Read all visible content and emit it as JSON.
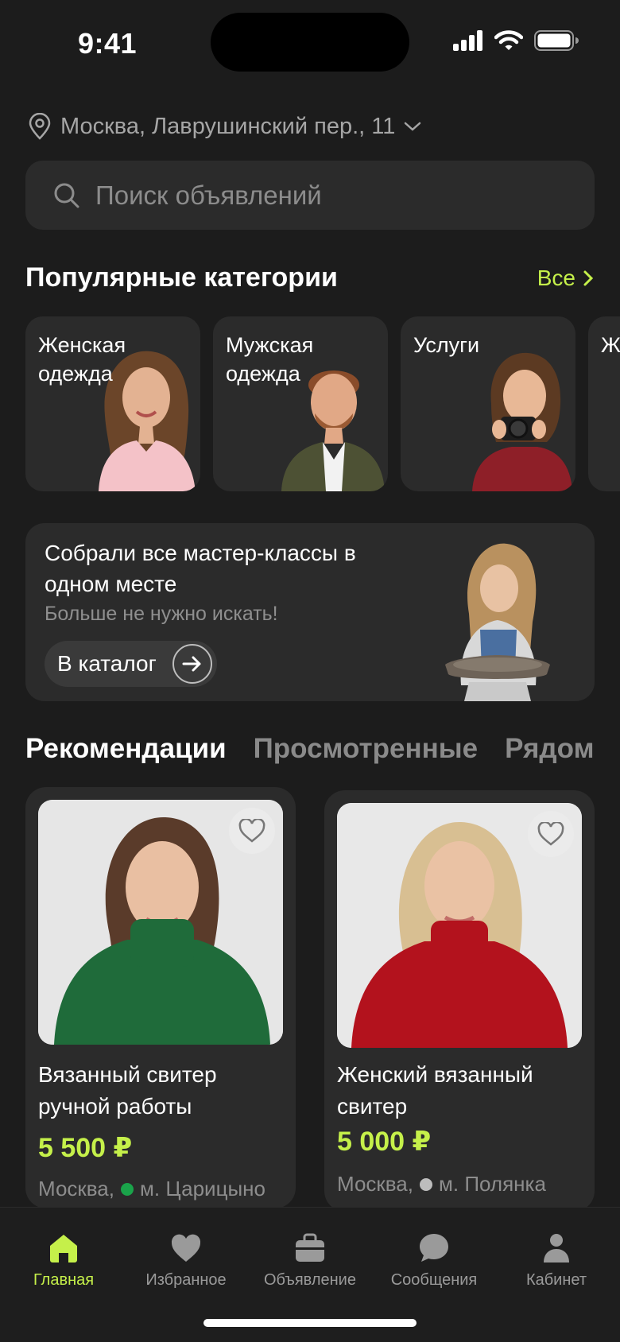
{
  "status_bar": {
    "time": "9:41"
  },
  "location": {
    "address": "Москва, Лаврушинский пер., 11"
  },
  "search": {
    "placeholder": "Поиск объявлений"
  },
  "categories_section": {
    "title": "Популярные категории",
    "all_label": "Все",
    "items": [
      {
        "label": "Женская одежда"
      },
      {
        "label": "Мужская одежда"
      },
      {
        "label": "Услуги"
      },
      {
        "label": "Ж"
      }
    ]
  },
  "promo": {
    "title": "Собрали все мастер-классы в одном месте",
    "subtitle": "Больше не нужно искать!",
    "button_label": "В каталог"
  },
  "tabs": [
    {
      "label": "Рекомендации",
      "active": true
    },
    {
      "label": "Просмотренные",
      "active": false
    },
    {
      "label": "Рядом",
      "active": false
    }
  ],
  "products": [
    {
      "title": "Вязанный свитер ручной работы",
      "price": "5 500 ₽",
      "city": "Москва,",
      "metro": "м. Царицыно",
      "metro_color": "#1aa34a",
      "sweater_color": "#1f6b3a"
    },
    {
      "title": "Женский вязанный свитер",
      "price": "5 000 ₽",
      "city": "Москва,",
      "metro": "м. Полянка",
      "metro_color": "#bdbdbd",
      "sweater_color": "#b3121d"
    }
  ],
  "bottom_nav": [
    {
      "label": "Главная",
      "icon": "home-icon",
      "active": true
    },
    {
      "label": "Избранное",
      "icon": "heart-icon",
      "active": false
    },
    {
      "label": "Объявление",
      "icon": "briefcase-icon",
      "active": false
    },
    {
      "label": "Сообщения",
      "icon": "chat-icon",
      "active": false
    },
    {
      "label": "Кабинет",
      "icon": "profile-icon",
      "active": false
    }
  ],
  "colors": {
    "accent": "#c5f04a",
    "background": "#1c1c1c",
    "surface": "#2b2b2b"
  }
}
